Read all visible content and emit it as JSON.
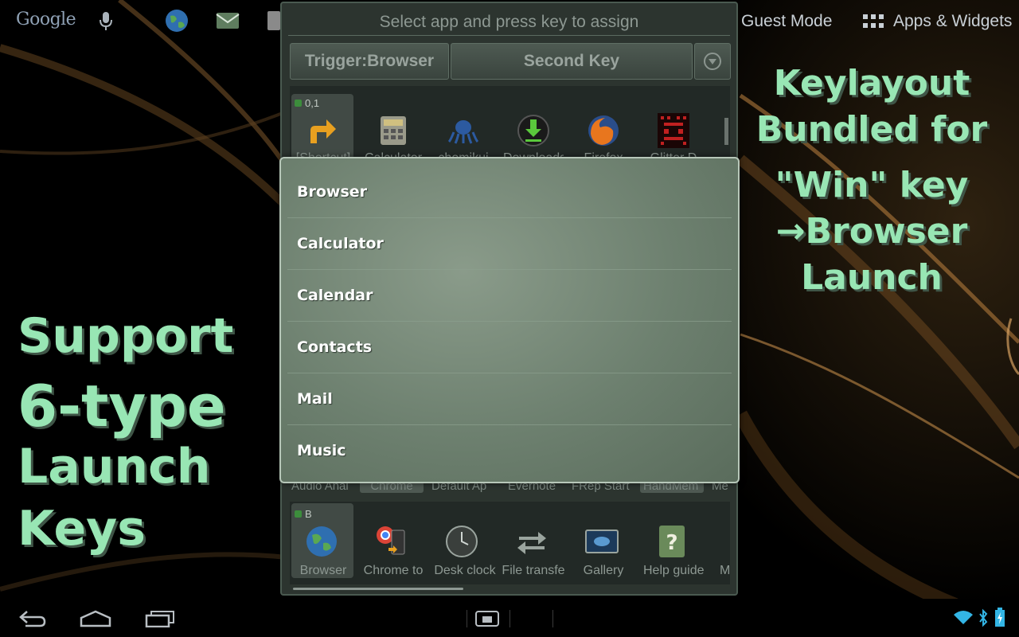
{
  "topbar": {
    "google_label": "Google",
    "guest_mode_label": "Guest Mode",
    "apps_widgets_label": "Apps & Widgets"
  },
  "promo": {
    "left_lines": [
      "Support",
      "6-type",
      "Launch",
      "Keys"
    ],
    "right_lines": [
      "Keylayout",
      "Bundled for",
      "\"Win\" key",
      "→Browser",
      "Launch"
    ]
  },
  "panel": {
    "title": "Select app and press key to assign",
    "trigger_button_label": "Trigger:Browser",
    "second_key_button_label": "Second Key",
    "slot_top_label": "0,1",
    "slot_bottom_label": "B",
    "top_row_apps": [
      {
        "name": "[Shortcut]",
        "icon": "shortcut-arrow-icon"
      },
      {
        "name": "Calculator",
        "icon": "calculator-icon"
      },
      {
        "name": "chomikuj",
        "icon": "octopus-icon"
      },
      {
        "name": "Downloads",
        "icon": "download-icon"
      },
      {
        "name": "Firefox",
        "icon": "firefox-icon"
      },
      {
        "name": "Glitter D",
        "icon": "glitter-icon"
      }
    ],
    "middle_row_labels": [
      "Audio Anal",
      "Chrome",
      "Default Ap",
      "Evernote",
      "FRep Start",
      "HandMem",
      "Me"
    ],
    "bottom_row_apps": [
      {
        "name": "Browser",
        "icon": "globe-icon"
      },
      {
        "name": "Chrome to",
        "icon": "chrome-to-phone-icon"
      },
      {
        "name": "Desk clock",
        "icon": "clock-icon"
      },
      {
        "name": "File transfe",
        "icon": "file-transfer-icon"
      },
      {
        "name": "Gallery",
        "icon": "gallery-icon"
      },
      {
        "name": "Help guide",
        "icon": "help-icon"
      },
      {
        "name": "M",
        "icon": "app-icon"
      }
    ]
  },
  "popup": {
    "items": [
      "Browser",
      "Calculator",
      "Calendar",
      "Contacts",
      "Mail",
      "Music"
    ]
  },
  "colors": {
    "promo_text": "#98e6b4",
    "popup_bg": "#6d806f",
    "panel_bg": "#2c342f"
  }
}
